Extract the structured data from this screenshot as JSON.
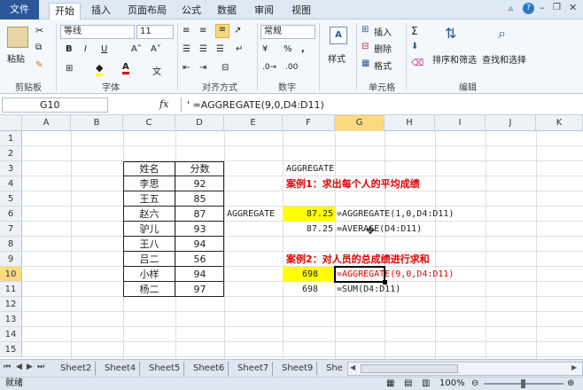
{
  "ribbon_tabs": [
    "文件",
    "开始",
    "插入",
    "页面布局",
    "公式",
    "数据",
    "审阅",
    "视图"
  ],
  "ribbon": {
    "paste": "粘贴",
    "clipboard": "剪贴板",
    "font_name": "等线",
    "font_size": "11",
    "font_group": "字体",
    "align_group": "对齐方式",
    "number_format": "常规",
    "number_group": "数字",
    "styles": "样式",
    "insert": "插入",
    "delete": "删除",
    "format": "格式",
    "cells_group": "单元格",
    "sort_filter": "排序和筛选",
    "find_select": "查找和选择",
    "editing_group": "编辑",
    "font_color_hint": "A",
    "bold": "B",
    "italic": "I",
    "underline": "U",
    "wen": "文",
    "percent": "%",
    "comma": ","
  },
  "formula_bar": {
    "name_box": "G10",
    "fx": "fx",
    "formula": "' =AGGREGATE(9,0,D4:D11)"
  },
  "columns": [
    "A",
    "B",
    "C",
    "D",
    "E",
    "F",
    "G",
    "H",
    "I",
    "J",
    "K"
  ],
  "rows": [
    "1",
    "2",
    "3",
    "4",
    "5",
    "6",
    "7",
    "8",
    "9",
    "10",
    "11",
    "12",
    "13",
    "14",
    "15"
  ],
  "table": {
    "header_name": "姓名",
    "header_score": "分数",
    "rows": [
      {
        "name": "李思",
        "score": "92"
      },
      {
        "name": "王五",
        "score": "85"
      },
      {
        "name": "赵六",
        "score": "87"
      },
      {
        "name": "驴儿",
        "score": "93"
      },
      {
        "name": "王八",
        "score": "94"
      },
      {
        "name": "吕二",
        "score": "56"
      },
      {
        "name": "小样",
        "score": "94"
      },
      {
        "name": "杨二",
        "score": "97"
      }
    ]
  },
  "cells": {
    "f3": "AGGREGATE",
    "f4": "案例1：求出每个人的平均成绩",
    "e6": "AGGREGATE",
    "f6": "87.25",
    "g6": "=AGGREGATE(1,0,D4:D11)",
    "f7": "87.25",
    "g7": "=AVERAGE(D4:D11)",
    "f9": "案例2：对人员的总成绩进行求和",
    "f10": "698",
    "g10": "=AGGREGATE(9,0,D4:D11)",
    "f11": "698",
    "g11": "=SUM(D4:D11)"
  },
  "sheet_tabs": [
    "Sheet2",
    "Sheet4",
    "Sheet5",
    "Sheet6",
    "Sheet7",
    "Sheet9",
    "She"
  ],
  "status": {
    "ready": "就绪",
    "zoom": "100%"
  },
  "colors": {
    "file_tab": "#2b579a",
    "highlight": "#ffff00",
    "red_text": "#e00000",
    "selection": "#f9d981"
  }
}
